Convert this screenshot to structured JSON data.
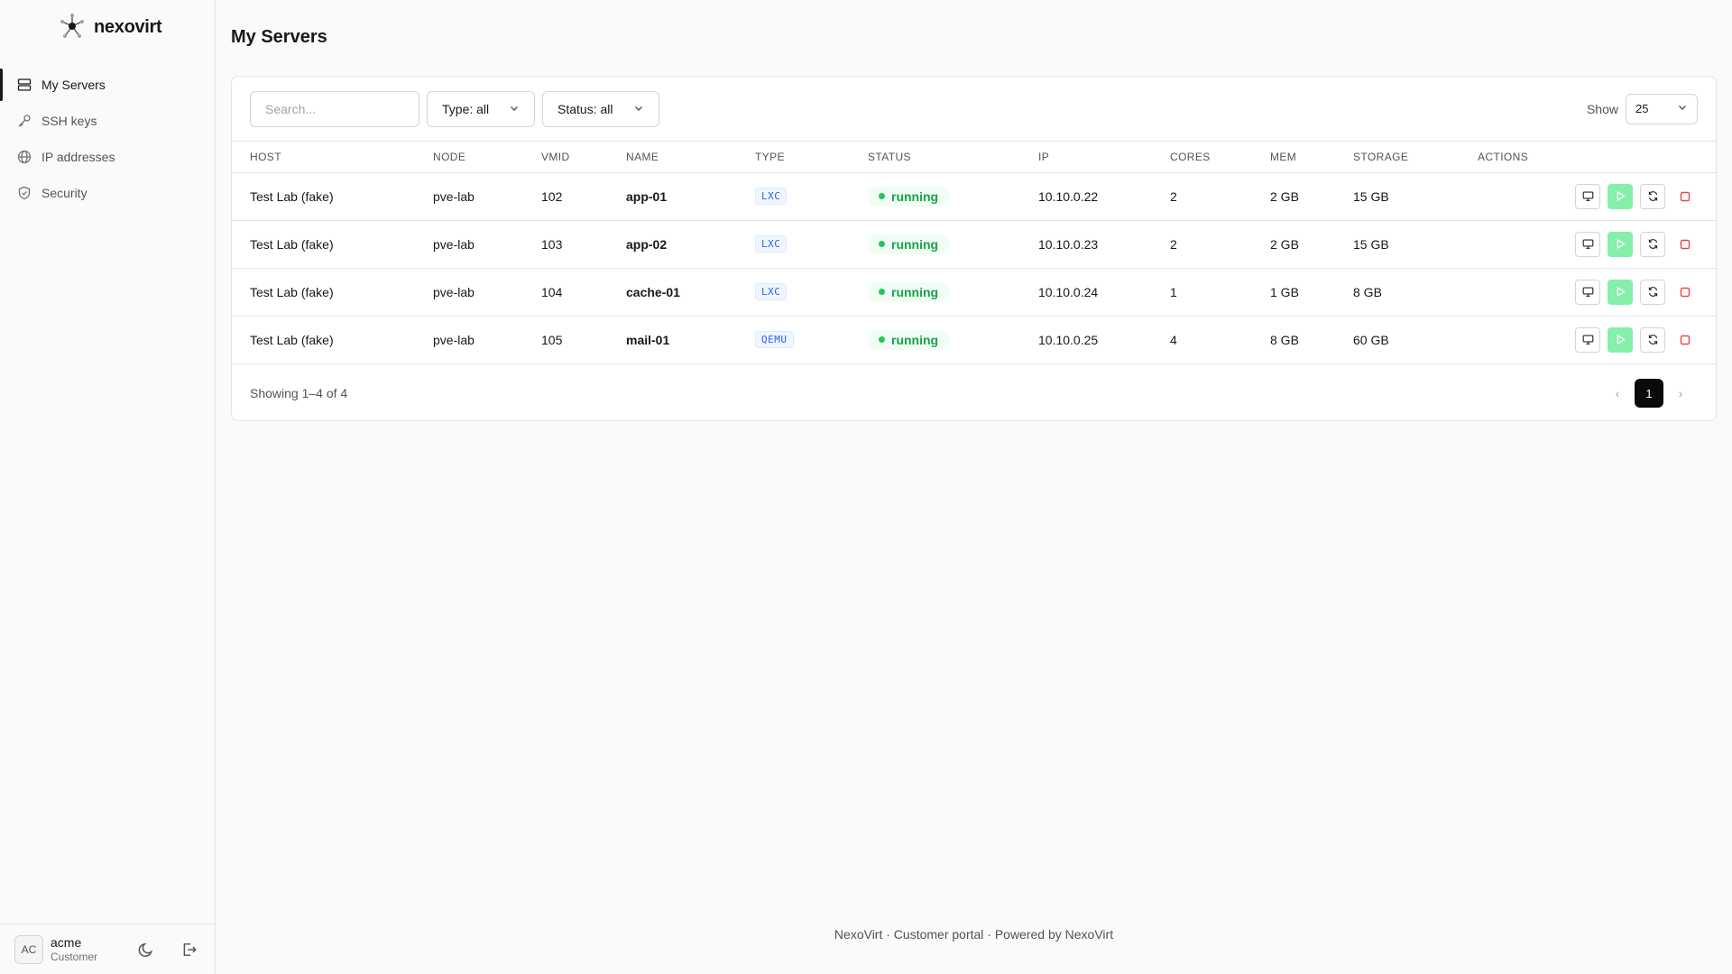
{
  "brand": {
    "name": "nexovirt"
  },
  "sidebar": {
    "items": [
      {
        "label": "My Servers",
        "icon": "servers-icon",
        "active": true
      },
      {
        "label": "SSH keys",
        "icon": "key-icon"
      },
      {
        "label": "IP addresses",
        "icon": "globe-icon"
      },
      {
        "label": "Security",
        "icon": "shield-icon"
      }
    ]
  },
  "user": {
    "initials": "AC",
    "name": "acme",
    "role": "Customer"
  },
  "page": {
    "title": "My Servers"
  },
  "toolbar": {
    "search_placeholder": "Search...",
    "type_filter": "Type: all",
    "status_filter": "Status: all",
    "show_label": "Show",
    "page_size": "25"
  },
  "table": {
    "headers": [
      "HOST",
      "NODE",
      "VMID",
      "NAME",
      "TYPE",
      "STATUS",
      "IP",
      "CORES",
      "MEM",
      "STORAGE",
      "ACTIONS"
    ],
    "rows": [
      {
        "host": "Test Lab (fake)",
        "node": "pve-lab",
        "vmid": "102",
        "name": "app-01",
        "type": "LXC",
        "status": "running",
        "ip": "10.10.0.22",
        "cores": "2",
        "mem": "2 GB",
        "storage": "15 GB"
      },
      {
        "host": "Test Lab (fake)",
        "node": "pve-lab",
        "vmid": "103",
        "name": "app-02",
        "type": "LXC",
        "status": "running",
        "ip": "10.10.0.23",
        "cores": "2",
        "mem": "2 GB",
        "storage": "15 GB"
      },
      {
        "host": "Test Lab (fake)",
        "node": "pve-lab",
        "vmid": "104",
        "name": "cache-01",
        "type": "LXC",
        "status": "running",
        "ip": "10.10.0.24",
        "cores": "1",
        "mem": "1 GB",
        "storage": "8 GB"
      },
      {
        "host": "Test Lab (fake)",
        "node": "pve-lab",
        "vmid": "105",
        "name": "mail-01",
        "type": "QEMU",
        "status": "running",
        "ip": "10.10.0.25",
        "cores": "4",
        "mem": "8 GB",
        "storage": "60 GB"
      }
    ]
  },
  "pagination": {
    "summary": "Showing 1–4 of 4",
    "prev": "‹",
    "current": "1",
    "next": "›"
  },
  "footer": {
    "text": "NexoVirt · Customer portal · Powered by NexoVirt"
  },
  "colors": {
    "accent": "#0a0a0a",
    "running": "#16a34a",
    "play": "#86efac",
    "stop": "#ef4444",
    "type_badge": "#2563eb"
  }
}
